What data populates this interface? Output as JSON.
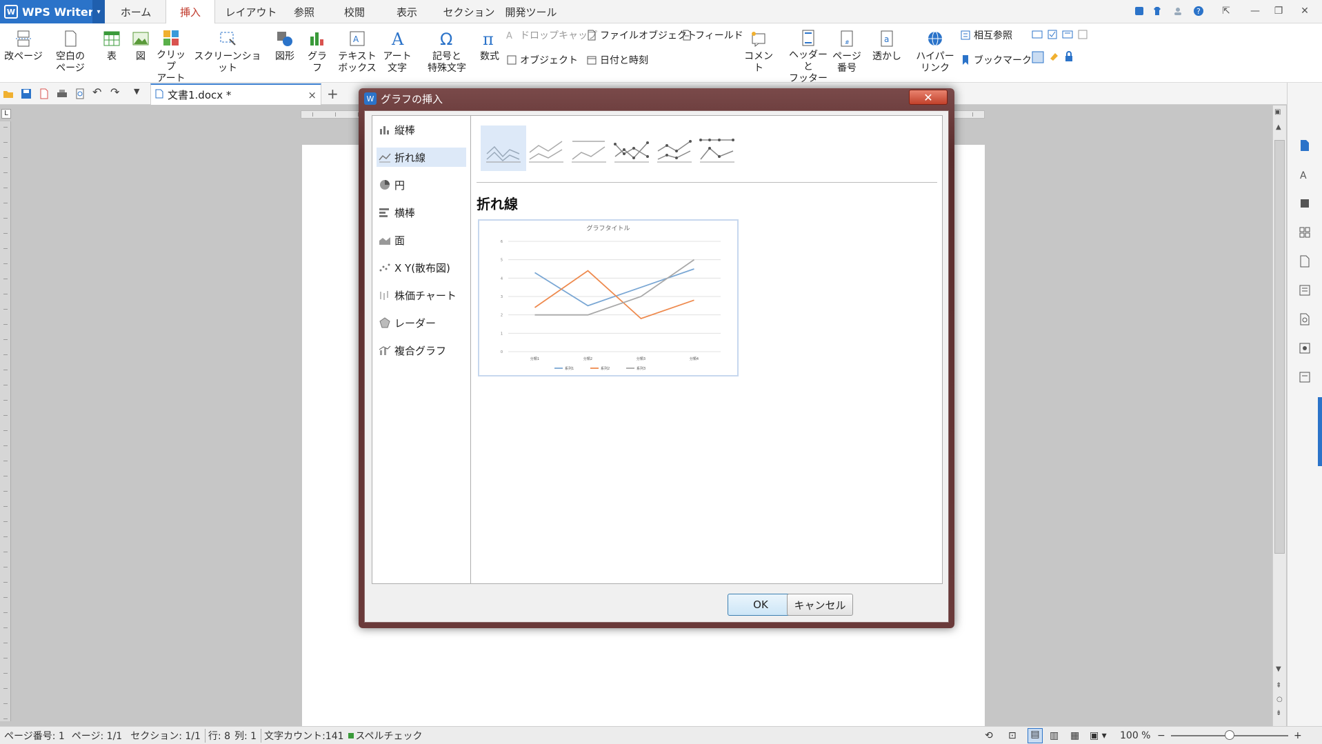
{
  "app": {
    "name": "WPS Writer"
  },
  "menu_tabs": [
    "ホーム",
    "挿入",
    "レイアウト",
    "参照",
    "校閲",
    "表示",
    "セクション",
    "開発ツール"
  ],
  "active_tab": "挿入",
  "ribbon": {
    "page_break": "改ページ",
    "blank_page_1": "空白の",
    "blank_page_2": "ページ",
    "table": "表",
    "picture": "図",
    "clipart_1": "クリップ",
    "clipart_2": "アート",
    "screenshot": "スクリーンショット",
    "shapes": "図形",
    "chart": "グラフ",
    "textbox_1": "テキスト",
    "textbox_2": "ボックス",
    "wordart_1": "アート",
    "wordart_2": "文字",
    "symbol_1": "記号と",
    "symbol_2": "特殊文字",
    "equation": "数式",
    "dropcap": "ドロップキャップ",
    "object": "オブジェクト",
    "file_object": "ファイルオブジェクト",
    "datetime": "日付と時刻",
    "field": "フィールド",
    "comment": "コメント",
    "header_footer_1": "ヘッダーと",
    "header_footer_2": "フッター",
    "page_number_1": "ページ",
    "page_number_2": "番号",
    "watermark": "透かし",
    "hyperlink_1": "ハイパー",
    "hyperlink_2": "リンク",
    "cross_ref": "相互参照",
    "bookmark": "ブックマーク"
  },
  "document_tab": {
    "name": "文書1.docx *",
    "close": "×",
    "new": "+"
  },
  "dialog": {
    "title": "グラフの挿入",
    "close": "✕",
    "categories": [
      "縦棒",
      "折れ線",
      "円",
      "横棒",
      "面",
      "X Y(散布図)",
      "株価チャート",
      "レーダー",
      "複合グラフ"
    ],
    "selected_category": "折れ線",
    "selected_name": "折れ線",
    "ok": "OK",
    "cancel": "キャンセル"
  },
  "chart_data": {
    "type": "line",
    "title": "グラフタイトル",
    "categories": [
      "分類1",
      "分類2",
      "分類3",
      "分類4"
    ],
    "ylim": [
      0,
      6
    ],
    "yticks": [
      0,
      1,
      2,
      3,
      4,
      5,
      6
    ],
    "series": [
      {
        "name": "系列1",
        "values": [
          4.3,
          2.5,
          3.5,
          4.5
        ],
        "color": "#7aa7d4"
      },
      {
        "name": "系列2",
        "values": [
          2.4,
          4.4,
          1.8,
          2.8
        ],
        "color": "#ee8a4e"
      },
      {
        "name": "系列3",
        "values": [
          2.0,
          2.0,
          3.0,
          5.0
        ],
        "color": "#a8a8a8"
      }
    ],
    "legend": "bottom",
    "grid": true
  },
  "statusbar": {
    "page_num": "ページ番号: 1",
    "page": "ページ: 1/1",
    "section": "セクション: 1/1",
    "line": "行: 8",
    "col": "列: 1",
    "word_count": "文字カウント:141",
    "spellcheck": "スペルチェック",
    "zoom": "100 %"
  },
  "colors": {
    "accent": "#2b73c9",
    "active_tab_text": "#c0392b"
  }
}
